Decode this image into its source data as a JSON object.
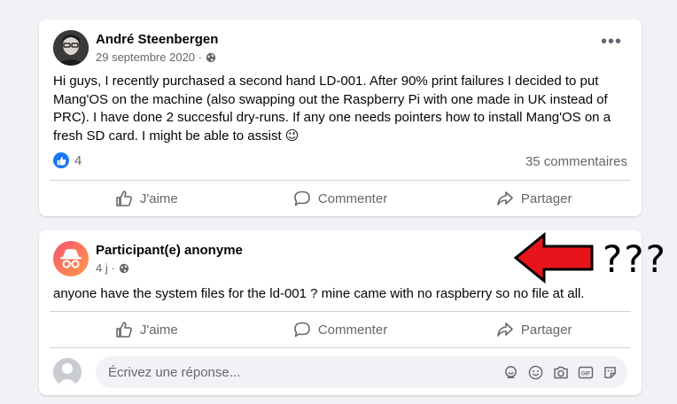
{
  "post1": {
    "author": "André Steenbergen",
    "date": "29 septembre 2020 ·",
    "audience_icon": "globe-icon",
    "body": "Hi guys, I recently purchased a second hand LD-001. After 90% print failures I decided to put Mang'OS on the machine (also swapping out the Raspberry Pi with one made in UK instead of PRC). I have done 2 succesful dry-runs. If any one needs pointers how to install Mang'OS on a fresh SD card. I might be able to assist",
    "emoji": "😉",
    "reactions_count": "4",
    "comments_count": "35 commentaires",
    "actions": {
      "like": "J'aime",
      "comment": "Commenter",
      "share": "Partager"
    }
  },
  "post2": {
    "author": "Participant(e) anonyme",
    "date": "4 j ·",
    "audience_icon": "globe-icon",
    "body": "anyone have the system files for the ld-001 ? mine came with no raspberry so no file at all.",
    "actions": {
      "like": "J'aime",
      "comment": "Commenter",
      "share": "Partager"
    },
    "reply_placeholder": "Écrivez une réponse..."
  },
  "annotation": {
    "text": "???",
    "arrow_color": "#e8141b"
  },
  "colors": {
    "like_blue": "#1877f2",
    "secondary_text": "#65676b",
    "anonymous_gradient_top": "#f5536d",
    "anonymous_gradient_bottom": "#ff9a4a"
  }
}
